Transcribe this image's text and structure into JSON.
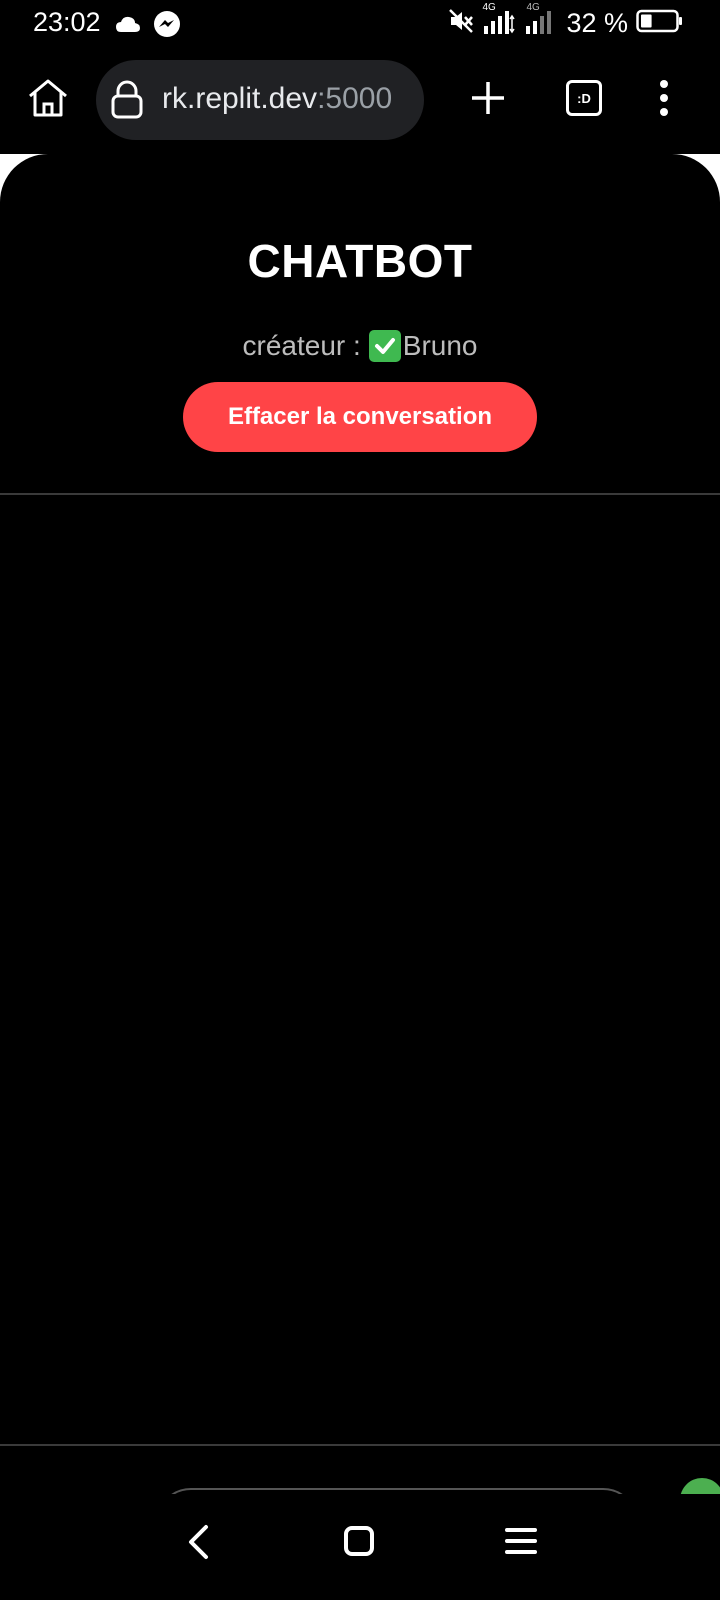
{
  "status_bar": {
    "time": "23:02",
    "battery_percent": "32 %",
    "network_1": "4G",
    "network_2": "4G",
    "battery_level": 0.32
  },
  "browser": {
    "url_host": "rk.replit.dev",
    "url_port": ":5000",
    "tabs_badge": ":D"
  },
  "chat": {
    "title": "CHATBOT",
    "creator_label": "créateur :",
    "creator_name": "Bruno",
    "clear_button": "Effacer la conversation"
  },
  "colors": {
    "accent_red": "#ff4447",
    "send_green": "#4caf50",
    "check_green": "#3fb950"
  }
}
